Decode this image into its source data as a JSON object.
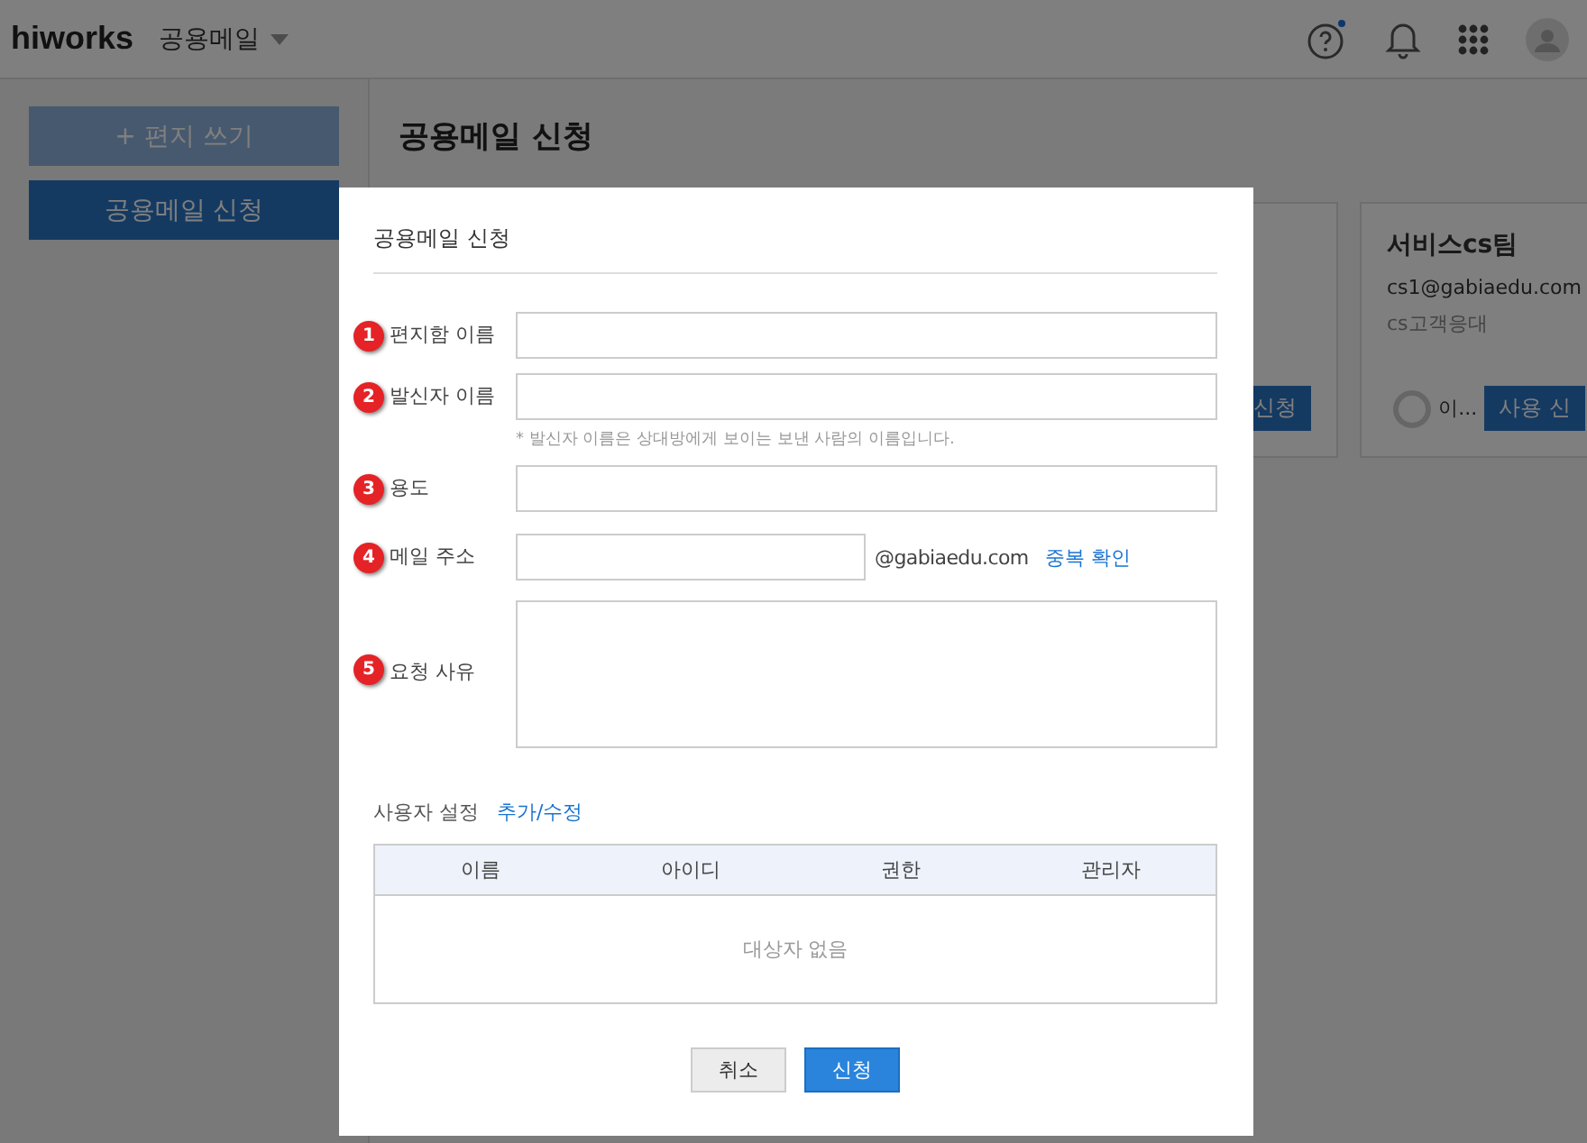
{
  "header": {
    "logo": "hiworks",
    "app_menu": "공용메일",
    "help_has_notice": true
  },
  "sidebar": {
    "compose_button": "+ 편지 쓰기",
    "request_button": "공용메일 신청"
  },
  "page_title": "공용메일 신청",
  "cards": [
    {
      "button": "신청"
    },
    {
      "title": "서비스cs팀",
      "email": "cs1@gabiaedu.com",
      "description": "cs고객응대",
      "user": "이...",
      "button": "사용 신"
    }
  ],
  "dialog": {
    "title": "공용메일 신청",
    "fields": [
      {
        "number": "1",
        "label": "편지함 이름",
        "kind": "text"
      },
      {
        "number": "2",
        "label": "발신자 이름",
        "kind": "text",
        "hint": "* 발신자 이름은 상대방에게 보이는 보낸 사람의 이름입니다."
      },
      {
        "number": "3",
        "label": "용도",
        "kind": "text"
      },
      {
        "number": "4",
        "label": "메일 주소",
        "kind": "email",
        "domain": "@gabiaedu.com",
        "link": "중복 확인"
      },
      {
        "number": "5",
        "label": "요청 사유",
        "kind": "textarea"
      }
    ],
    "users_label": "사용자 설정",
    "users_link": "추가/수정",
    "table": {
      "columns": [
        "이름",
        "아이디",
        "권한",
        "관리자"
      ],
      "empty": "대상자 없음"
    },
    "buttons": [
      {
        "label": "취소",
        "kind": "secondary"
      },
      {
        "label": "신청",
        "kind": "primary"
      }
    ]
  }
}
